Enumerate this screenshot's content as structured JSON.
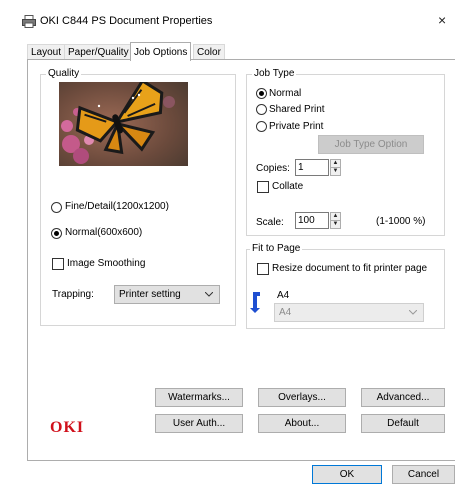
{
  "window": {
    "title": "OKI C844 PS Document Properties",
    "close_glyph": "×"
  },
  "tabs": [
    "Layout",
    "Paper/Quality",
    "Job Options",
    "Color"
  ],
  "active_tab": "Job Options",
  "quality": {
    "group_label": "Quality",
    "option_fine": "Fine/Detail(1200x1200)",
    "option_normal": "Normal(600x600)",
    "selected": "Normal(600x600)",
    "image_smoothing_label": "Image Smoothing",
    "image_smoothing_checked": false,
    "trapping_label": "Trapping:",
    "trapping_value": "Printer setting"
  },
  "job_type": {
    "group_label": "Job Type",
    "option_normal": "Normal",
    "option_shared": "Shared Print",
    "option_private": "Private Print",
    "selected": "Normal",
    "job_type_option_button": "Job Type Option",
    "copies_label": "Copies:",
    "copies_value": "1",
    "collate_label": "Collate",
    "collate_checked": false,
    "scale_label": "Scale:",
    "scale_value": "100",
    "scale_range": "(1-1000 %)"
  },
  "fit_to_page": {
    "group_label": "Fit to Page",
    "resize_label": "Resize document to fit printer page",
    "resize_checked": false,
    "paper_label": "A4",
    "paper_value": "A4"
  },
  "buttons": {
    "watermarks": "Watermarks...",
    "overlays": "Overlays...",
    "advanced": "Advanced...",
    "user_auth": "User Auth...",
    "about": "About...",
    "default": "Default",
    "ok": "OK",
    "cancel": "Cancel"
  },
  "brand": {
    "logo_text": "OKI",
    "logo_color": "#d0101b"
  },
  "icons": {
    "printer": "printer-icon",
    "orientation": "portrait-arrow-icon",
    "dropdown": "chevron-down-icon"
  }
}
